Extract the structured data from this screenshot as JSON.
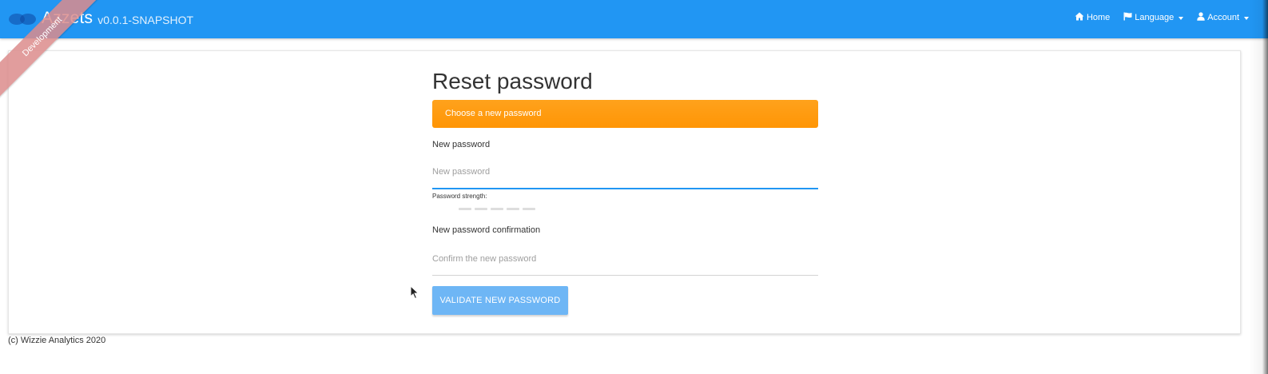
{
  "app": {
    "name": "Azzets",
    "version": "v0.0.1-SNAPSHOT",
    "ribbon": "Development"
  },
  "nav": {
    "home": "Home",
    "language": "Language",
    "account": "Account"
  },
  "form": {
    "title": "Reset password",
    "alert": "Choose a new password",
    "new_password_label": "New password",
    "new_password_placeholder": "New password",
    "new_password_value": "",
    "strength_label": "Password strength:",
    "strength_level": 0,
    "confirm_label": "New password confirmation",
    "confirm_placeholder": "Confirm the new password",
    "confirm_value": "",
    "submit_label": "VALIDATE NEW PASSWORD"
  },
  "footer": {
    "text": "(c) Wizzie Analytics 2020"
  },
  "colors": {
    "navbar": "#2196f3",
    "alert": "#ff9800",
    "button": "#6eb6f5",
    "ribbon": "#dc8c8c"
  },
  "icons": {
    "home": "home-icon",
    "language": "flag-icon",
    "account": "user-icon"
  }
}
